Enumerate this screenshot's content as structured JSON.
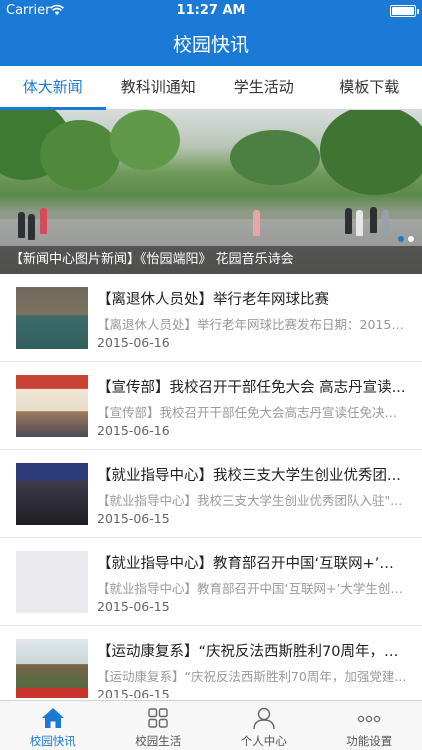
{
  "status": {
    "carrier": "Carrier",
    "time": "11:27 AM"
  },
  "nav": {
    "title": "校园快讯"
  },
  "tabs": [
    {
      "label": "体大新闻",
      "active": true
    },
    {
      "label": "教科训通知",
      "active": false
    },
    {
      "label": "学生活动",
      "active": false
    },
    {
      "label": "模板下载",
      "active": false
    }
  ],
  "banner": {
    "caption": "【新闻中心图片新闻】《怡园端阳》 花园音乐诗会",
    "page_count": 2,
    "current_page": 1
  },
  "news": [
    {
      "title": "【离退休人员处】举行老年网球比赛",
      "summary": "【离退休人员处】举行老年网球比赛发布日期：2015-0...",
      "date": "2015-06-16"
    },
    {
      "title": "【宣传部】我校召开干部任免大会 高志丹宣读...",
      "summary": "【宣传部】我校召开干部任免大会高志丹宣读任免决定...",
      "date": "2015-06-16"
    },
    {
      "title": "【就业指导中心】我校三支大学生创业优秀团...",
      "summary": "【就业指导中心】我校三支大学生创业优秀团队入驻\"...",
      "date": "2015-06-15"
    },
    {
      "title": "【就业指导中心】教育部召开中国‘互联网+’大...",
      "summary": "【就业指导中心】教育部召开中国‘互联网+’大学生创新...",
      "date": "2015-06-15"
    },
    {
      "title": "【运动康复系】“庆祝反法西斯胜利70周年，加...",
      "summary": "【运动康复系】“庆祝反法西斯胜利70周年，加强党建...",
      "date": "2015-06-15"
    }
  ],
  "tabbar": [
    {
      "label": "校园快讯",
      "icon": "home-icon",
      "active": true
    },
    {
      "label": "校园生活",
      "icon": "grid-icon",
      "active": false
    },
    {
      "label": "个人中心",
      "icon": "person-icon",
      "active": false
    },
    {
      "label": "功能设置",
      "icon": "more-icon",
      "active": false
    }
  ],
  "colors": {
    "accent": "#1b7ad6"
  }
}
